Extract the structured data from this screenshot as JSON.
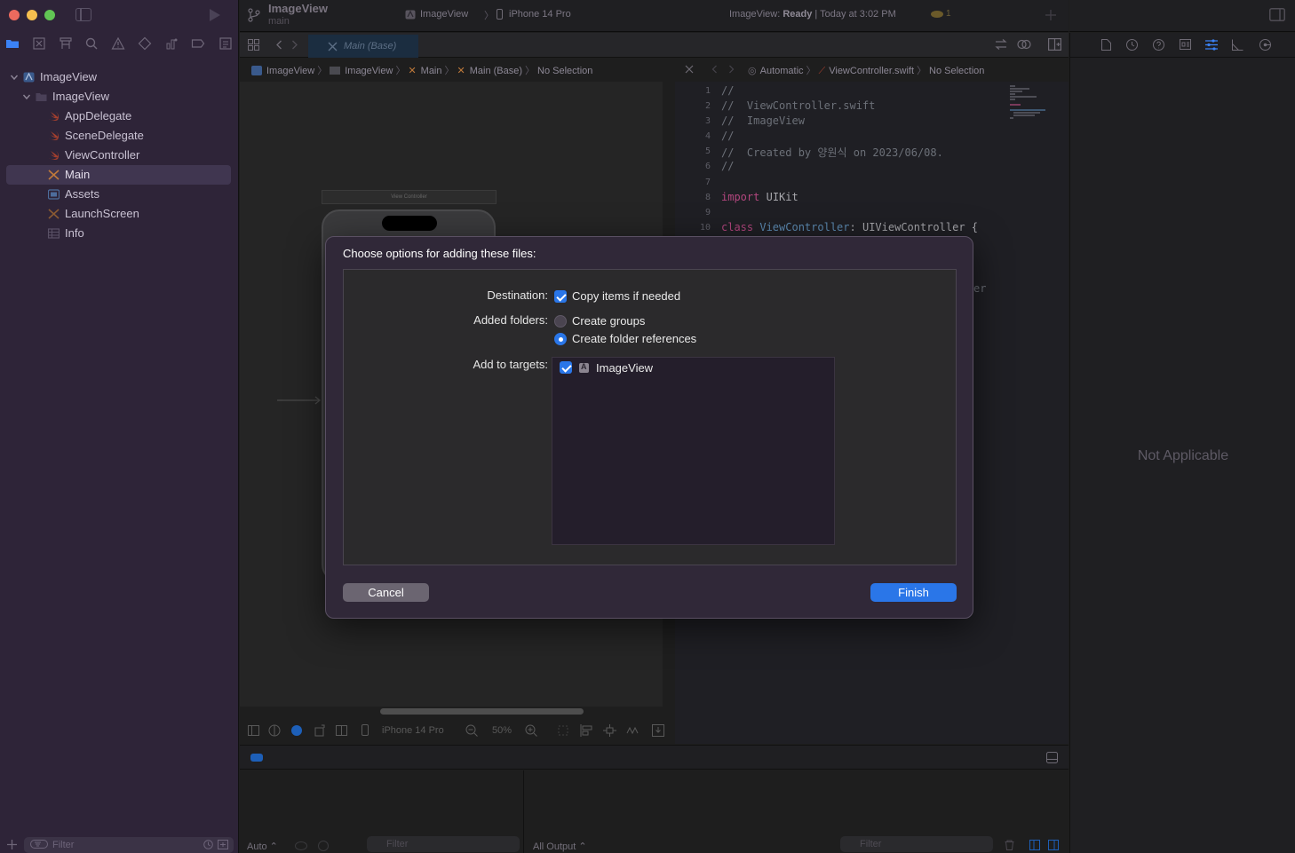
{
  "toolbar": {
    "project_name": "ImageView",
    "branch": "main",
    "scheme_target": "ImageView",
    "device": "iPhone 14 Pro",
    "status_prefix": "ImageView: ",
    "status_state": "Ready",
    "status_time": " | Today at 3:02 PM",
    "warning_count": "1"
  },
  "sidebar": {
    "filter_placeholder": "Filter",
    "tree": [
      {
        "label": "ImageView",
        "indent": 0,
        "icon": "project-icon",
        "chevron": true
      },
      {
        "label": "ImageView",
        "indent": 1,
        "icon": "folder-icon",
        "chevron": true
      },
      {
        "label": "AppDelegate",
        "indent": 2,
        "icon": "swift-file-icon",
        "chevron": false
      },
      {
        "label": "SceneDelegate",
        "indent": 2,
        "icon": "swift-file-icon",
        "chevron": false
      },
      {
        "label": "ViewController",
        "indent": 2,
        "icon": "swift-file-icon",
        "chevron": false
      },
      {
        "label": "Main",
        "indent": 2,
        "icon": "storyboard-icon",
        "chevron": false,
        "selected": true
      },
      {
        "label": "Assets",
        "indent": 2,
        "icon": "assets-icon",
        "chevron": false
      },
      {
        "label": "LaunchScreen",
        "indent": 2,
        "icon": "storyboard-icon",
        "chevron": false
      },
      {
        "label": "Info",
        "indent": 2,
        "icon": "plist-icon",
        "chevron": false
      }
    ]
  },
  "tabs": {
    "active": "Main (Base)"
  },
  "jumpbar_left": [
    "ImageView",
    "ImageView",
    "Main",
    "Main (Base)",
    "No Selection"
  ],
  "jumpbar_right": [
    "Automatic",
    "ViewController.swift",
    "No Selection"
  ],
  "canvas": {
    "scene_label": "View Controller",
    "device": "iPhone 14 Pro",
    "zoom": "50%"
  },
  "editor": {
    "lines": [
      {
        "n": "1",
        "text": "//",
        "kind": "comment"
      },
      {
        "n": "2",
        "text": "//  ViewController.swift",
        "kind": "comment"
      },
      {
        "n": "3",
        "text": "//  ImageView",
        "kind": "comment"
      },
      {
        "n": "4",
        "text": "//",
        "kind": "comment"
      },
      {
        "n": "5",
        "text": "//  Created by 양원식 on 2023/06/08.",
        "kind": "comment"
      },
      {
        "n": "6",
        "text": "//",
        "kind": "comment"
      },
      {
        "n": "7",
        "text": "",
        "kind": "plain"
      },
      {
        "n": "8",
        "text": "import UIKit",
        "kind": "import"
      },
      {
        "n": "9",
        "text": "",
        "kind": "plain"
      },
      {
        "n": "10",
        "text": "class ViewController: UIViewController {",
        "kind": "class"
      }
    ],
    "partial_text": "er"
  },
  "debug": {
    "auto_label": "Auto ⌃",
    "filter_placeholder": "Filter",
    "output_label": "All Output ⌃"
  },
  "inspector": {
    "empty_text": "Not Applicable"
  },
  "dialog": {
    "title": "Choose options for adding these files:",
    "destination_label": "Destination:",
    "copy_items": "Copy items if needed",
    "added_folders_label": "Added folders:",
    "create_groups": "Create groups",
    "create_folder_refs": "Create folder references",
    "add_to_targets_label": "Add to targets:",
    "target_name": "ImageView",
    "cancel": "Cancel",
    "finish": "Finish"
  },
  "colors": {
    "accent": "#2a76e8",
    "sidebar_bg": "#2e2438",
    "dialog_bg": "#302838",
    "traffic_red": "#ed6a5e",
    "traffic_yellow": "#f5bf4f",
    "traffic_green": "#61c554"
  }
}
